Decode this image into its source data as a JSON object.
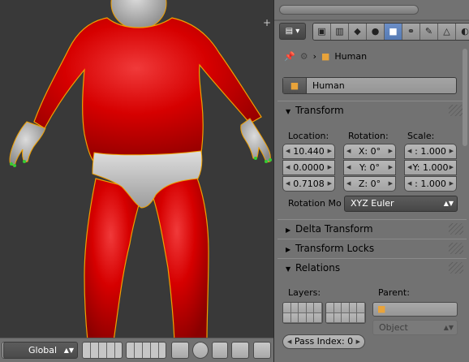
{
  "viewport": {
    "orientation_select": "Global",
    "plus_glyph": "+"
  },
  "properties": {
    "context_tabs": [
      "render-icon",
      "render-layers-icon",
      "scene-icon",
      "world-icon",
      "object-icon",
      "constraints-icon",
      "modifiers-icon",
      "data-icon",
      "material-icon"
    ],
    "active_tab": "object-icon",
    "breadcrumb_separator": "›",
    "breadcrumb_object": "Human",
    "object_name": "Human",
    "panels": {
      "transform": {
        "title": "Transform",
        "location_label": "Location:",
        "rotation_label": "Rotation:",
        "scale_label": "Scale:",
        "location": [
          "10.440",
          "0.0000",
          "0.7108"
        ],
        "rotation": [
          "X: 0°",
          "Y: 0°",
          "Z: 0°"
        ],
        "scale": [
          ": 1.000",
          "Y: 1.000",
          ": 1.000"
        ],
        "rotation_mode_label": "Rotation Mo",
        "rotation_mode_value": "XYZ Euler"
      },
      "delta_transform": {
        "title": "Delta Transform"
      },
      "transform_locks": {
        "title": "Transform Locks"
      },
      "relations": {
        "title": "Relations",
        "layers_label": "Layers:",
        "parent_label": "Parent:",
        "parent_type": "Object",
        "pass_index": "Pass Index: 0"
      }
    }
  },
  "colors": {
    "active_tab": "#5479b3",
    "object_orange": "#e8a33a",
    "body_red": "#cc0000",
    "selection_outline": "#f0a000"
  }
}
